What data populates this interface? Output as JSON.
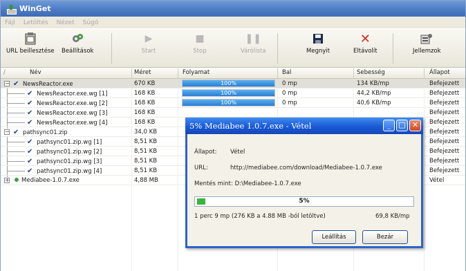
{
  "window": {
    "title": "WinGet"
  },
  "menu": [
    "Fájl",
    "Letöltés",
    "Nézet",
    "Súgó"
  ],
  "toolbar": {
    "url_paste": "URL beillesztése",
    "settings": "Beállítások",
    "start": "Start",
    "stop": "Stop",
    "queue": "Várólista",
    "open": "Megnyit",
    "remove": "Eltávolít",
    "properties": "Jellemzok"
  },
  "columns": {
    "name": "Név",
    "size": "Méret",
    "progress": "Folyamat",
    "remaining": "Bal",
    "speed": "Sebesség",
    "status": "Állapot"
  },
  "rows": [
    {
      "name": "NewsReactor.exe",
      "size": "670 KB",
      "progress": "100%",
      "progress_fraction": 1.0,
      "remaining": "0 mp",
      "speed": "134 KB/mp",
      "status": "Befejezett",
      "check": "✔"
    },
    {
      "name": "NewsReactor.exe.wg [1]",
      "size": "168 KB",
      "progress": "100%",
      "progress_fraction": 1.0,
      "remaining": "0 mp",
      "speed": "44,2 KB/mp",
      "status": "Befejezett",
      "check": "✔"
    },
    {
      "name": "NewsReactor.exe.wg [2]",
      "size": "168 KB",
      "progress": "100%",
      "progress_fraction": 1.0,
      "remaining": "0 mp",
      "speed": "40,6 KB/mp",
      "status": "Befejezett",
      "check": "✔"
    },
    {
      "name": "NewsReactor.exe.wg [3]",
      "size": "168 KB",
      "status": "Befejezett",
      "check": "✔"
    },
    {
      "name": "NewsReactor.exe.wg [4]",
      "size": "168 KB",
      "status": "Befejezett",
      "check": "✔"
    },
    {
      "name": "pathsync01.zip",
      "size": "34,0 KB",
      "status": "Befejezett",
      "check": "✔"
    },
    {
      "name": "pathsync01.zip.wg [1]",
      "size": "8,51 KB",
      "status": "Befejezett",
      "check": "✔"
    },
    {
      "name": "pathsync01.zip.wg [2]",
      "size": "8,51 KB",
      "status": "Befejezett",
      "check": "✔"
    },
    {
      "name": "pathsync01.zip.wg [3]",
      "size": "8,51 KB",
      "status": "Befejezett",
      "check": "✔"
    },
    {
      "name": "pathsync01.zip.wg [4]",
      "size": "8,51 KB",
      "status": "Befejezett",
      "check": "✔"
    },
    {
      "name": "Mediabee-1.0.7.exe",
      "size": "4,88 MB",
      "status": "Vétel"
    }
  ],
  "dialog": {
    "title": "5% Mediabee 1.0.7.exe - Vétel",
    "status_label": "Állapot:",
    "status_value": "Vétel",
    "url_label": "URL:",
    "url_value": "http://mediabee.com/download/Mediabee-1.0.7.exe",
    "save_as": "Mentés mint: D:\\Mediabee-1.0.7.exe",
    "percent": "5%",
    "percent_fraction": 0.05,
    "detail": "1 perc 9 mp (276 KB a 4.88 MB -ból letöltve)",
    "speed": "69,8 KB/mp",
    "stop_button": "Leállítás",
    "close_button": "Bezár"
  }
}
